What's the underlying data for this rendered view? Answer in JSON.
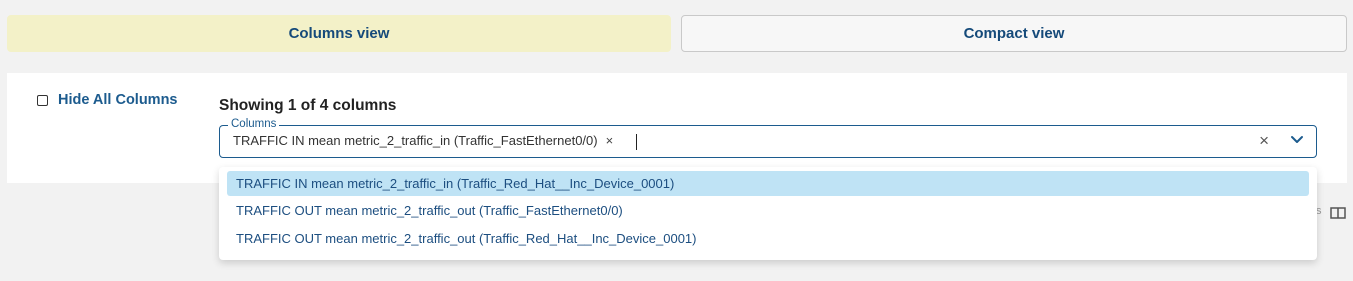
{
  "view_toggle": {
    "columns_view": "Columns view",
    "compact_view": "Compact view"
  },
  "panel": {
    "hide_all_label": "Hide All Columns",
    "showing_text": "Showing 1 of 4 columns",
    "columns_field": {
      "legend": "Columns",
      "selected": [
        {
          "label": "TRAFFIC IN mean metric_2_traffic_in (Traffic_FastEthernet0/0)",
          "remove": "×"
        }
      ],
      "clear_icon": "×"
    }
  },
  "dropdown": {
    "options": [
      "TRAFFIC IN mean metric_2_traffic_in (Traffic_Red_Hat__Inc_Device_0001)",
      "TRAFFIC OUT mean metric_2_traffic_out (Traffic_FastEthernet0/0)",
      "TRAFFIC OUT mean metric_2_traffic_out (Traffic_Red_Hat__Inc_Device_0001)"
    ]
  },
  "background": {
    "peek_text": "s"
  },
  "colors": {
    "accent": "#1c5b8e",
    "active_tab": "#f3f1c8",
    "highlight_option": "#bfe3f5"
  }
}
